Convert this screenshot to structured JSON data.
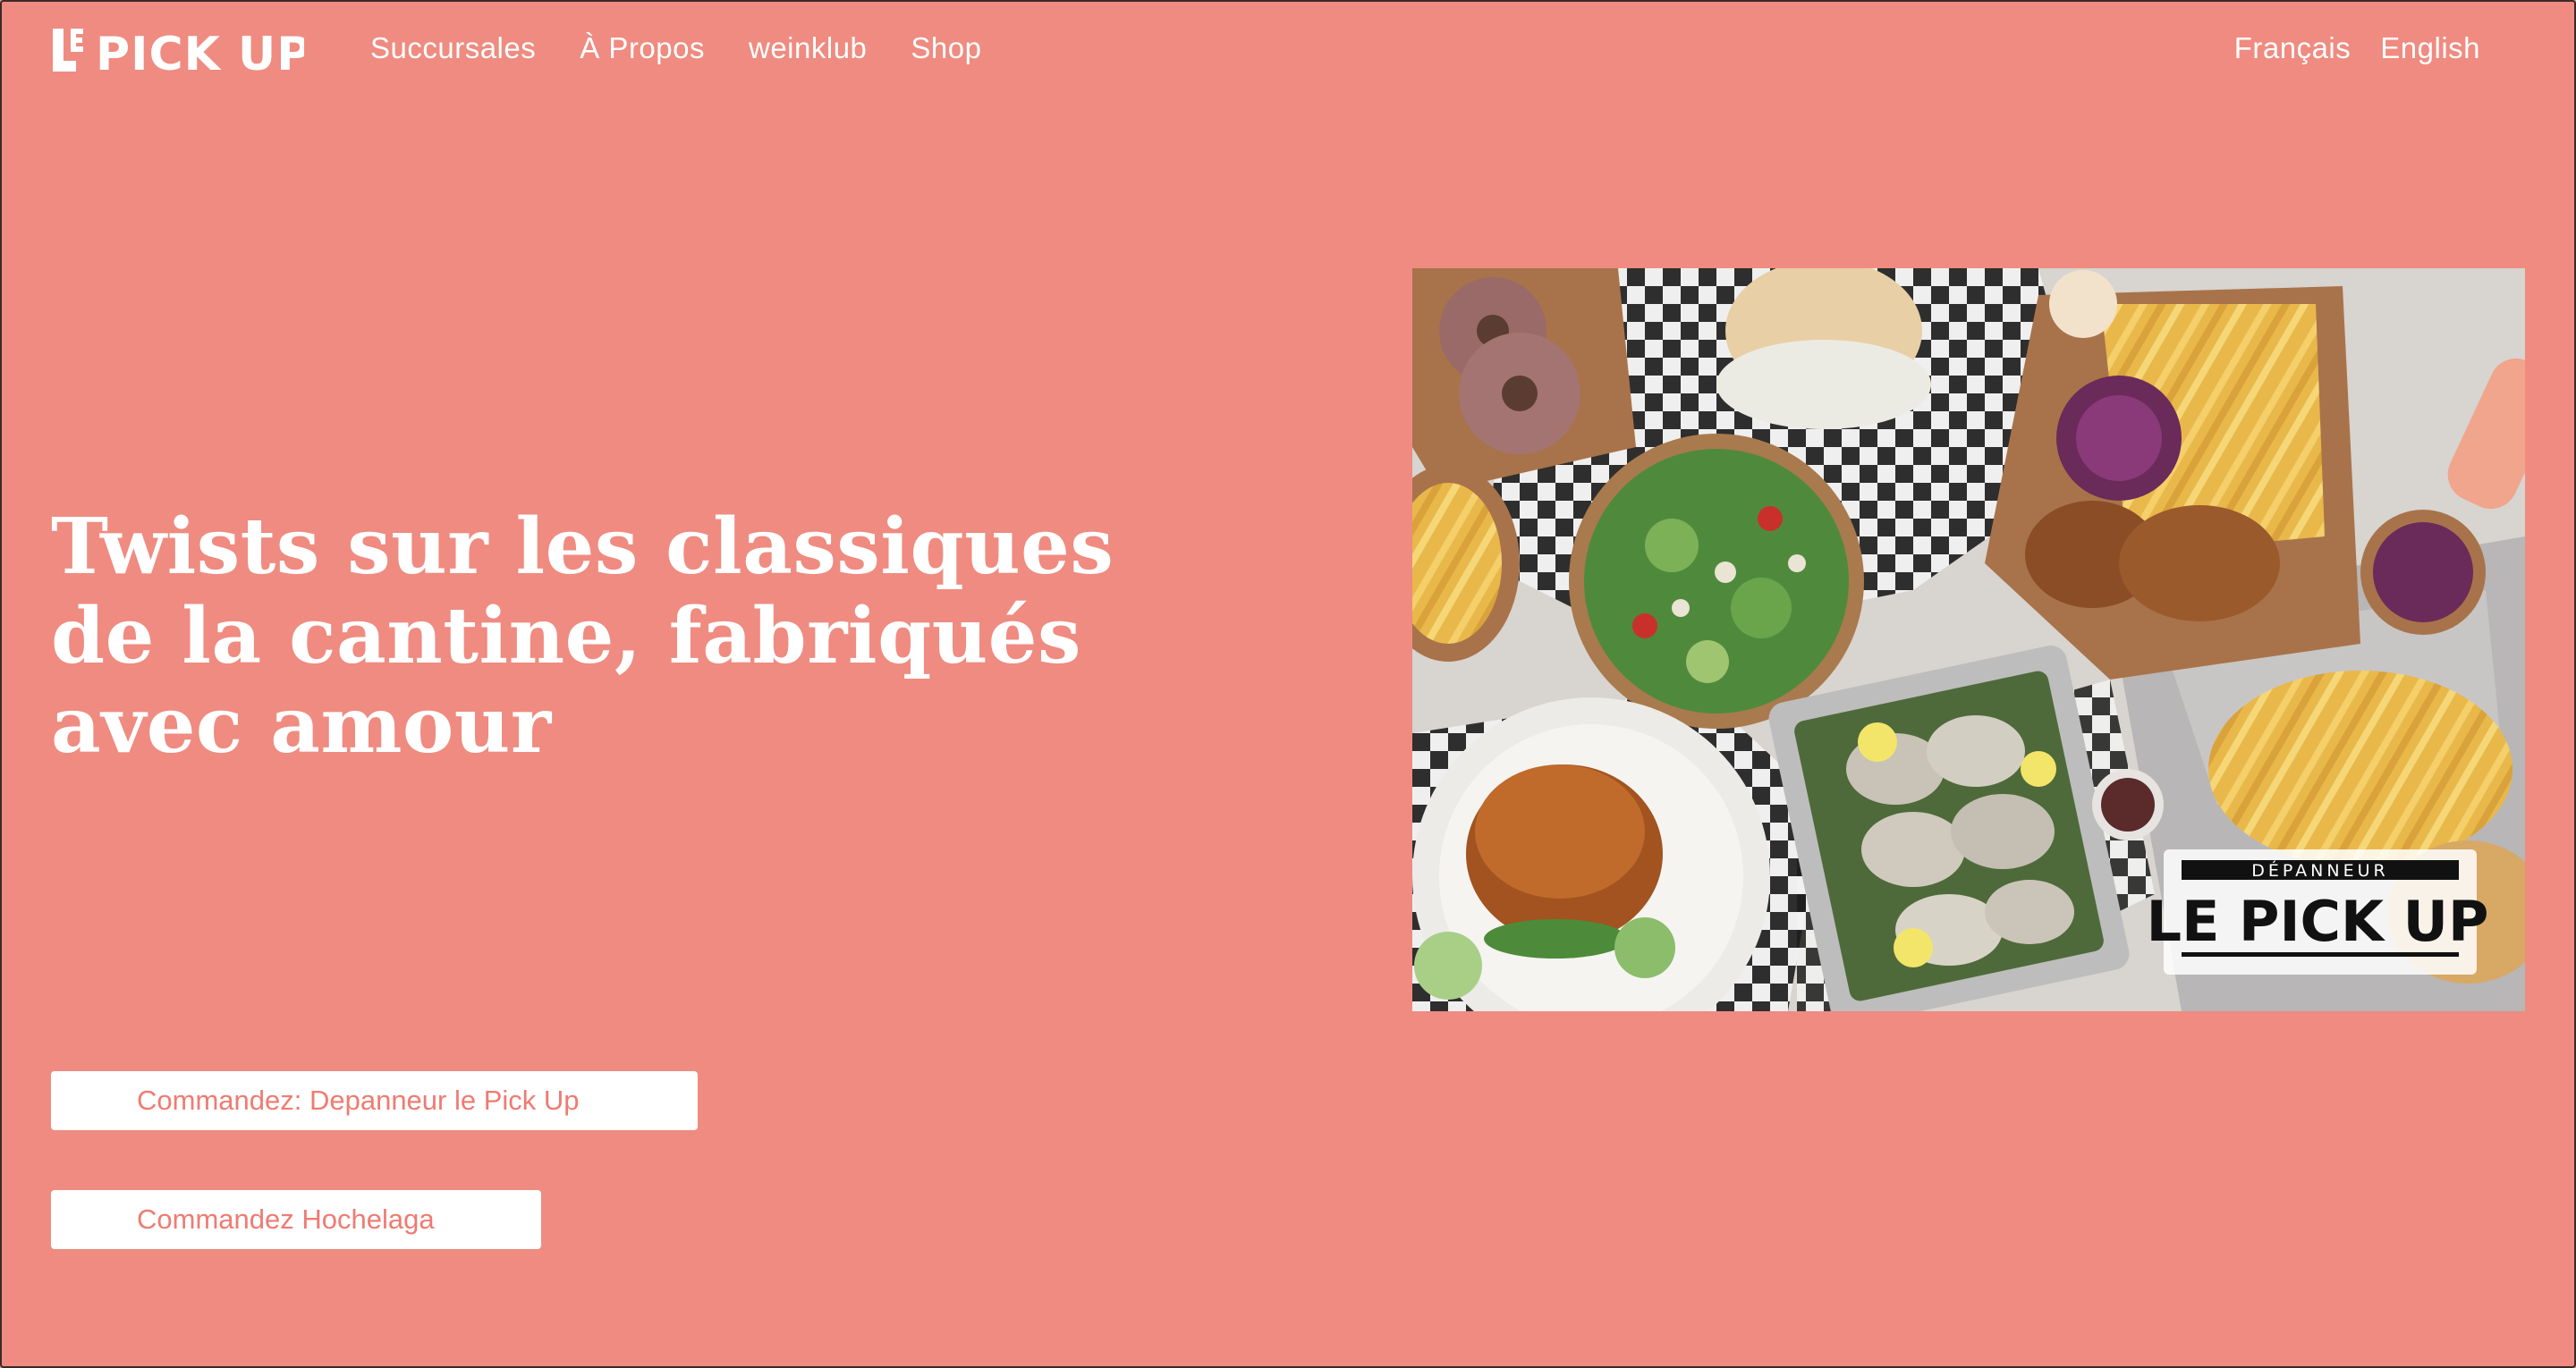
{
  "header": {
    "logo_text": "LE PICK UP",
    "nav": [
      {
        "label": "Succursales"
      },
      {
        "label": "À Propos"
      },
      {
        "label": "weinklub"
      },
      {
        "label": "Shop"
      }
    ],
    "languages": [
      {
        "label": "Français"
      },
      {
        "label": "English"
      }
    ]
  },
  "hero": {
    "title": "Twists sur les classiques de la cantine, fabriqués avec amour"
  },
  "buttons": {
    "order_pickup": "Commandez: Depanneur le Pick Up",
    "order_hochelaga": "Commandez Hochelaga"
  },
  "image": {
    "sign_top": "DÉPANNEUR",
    "sign_main": "LE PICK UP"
  },
  "colors": {
    "background": "#ef8b80",
    "button_bg": "#ffffff",
    "button_text": "#ef7b72",
    "text": "#ffffff"
  }
}
